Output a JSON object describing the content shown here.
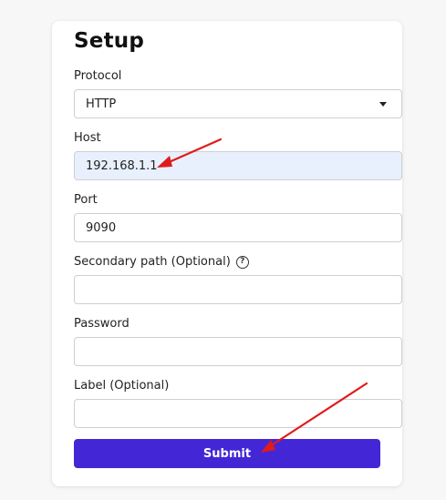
{
  "form": {
    "title": "Setup",
    "protocol": {
      "label": "Protocol",
      "value": "HTTP"
    },
    "host": {
      "label": "Host",
      "value": "192.168.1.1"
    },
    "port": {
      "label": "Port",
      "value": "9090"
    },
    "secondary_path": {
      "label": "Secondary path (Optional)",
      "value": "",
      "help_icon": "question-circle-icon"
    },
    "password": {
      "label": "Password",
      "value": ""
    },
    "label_field": {
      "label": "Label (Optional)",
      "value": ""
    },
    "submit_label": "Submit"
  },
  "annotations": {
    "color": "#e01b1b",
    "arrows": [
      "arrow-to-host",
      "arrow-to-submit"
    ]
  },
  "colors": {
    "accent": "#4327d6",
    "autofill_bg": "#e8f0fe"
  }
}
